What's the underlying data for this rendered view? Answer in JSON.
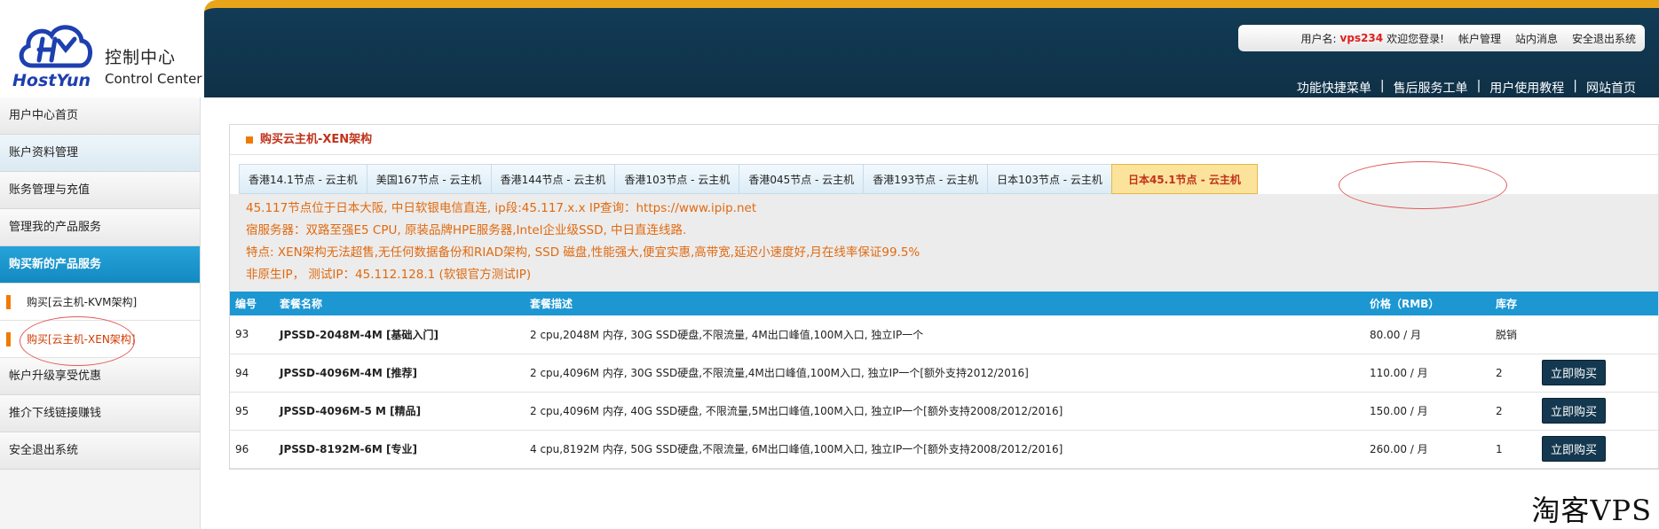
{
  "brand": {
    "logo_text": "HostYun",
    "title_cn": "控制中心",
    "title_en": "Control Center"
  },
  "user_bar": {
    "username_label": "用户名:",
    "username": "vps234",
    "welcome": "欢迎您登录!",
    "links": [
      "帐户管理",
      "站内消息",
      "安全退出系统"
    ]
  },
  "top_nav": [
    "功能快捷菜单",
    "售后服务工单",
    "用户使用教程",
    "网站首页"
  ],
  "sidebar": {
    "items": [
      {
        "label": "用户中心首页"
      },
      {
        "label": "账户资料管理"
      },
      {
        "label": "账务管理与充值"
      },
      {
        "label": "管理我的产品服务"
      },
      {
        "label": "购买新的产品服务"
      }
    ],
    "sub_items": [
      {
        "label": "购买[云主机-KVM架构]"
      },
      {
        "label": "购买[云主机-XEN架构]"
      }
    ],
    "bottom_items": [
      {
        "label": "帐户升级享受优惠"
      },
      {
        "label": "推介下线链接赚钱"
      },
      {
        "label": "安全退出系统"
      }
    ]
  },
  "panel": {
    "title": "购买云主机-XEN架构",
    "tabs": [
      "香港14.1节点 - 云主机",
      "美国167节点 - 云主机",
      "香港144节点 - 云主机",
      "香港103节点 - 云主机",
      "香港045节点 - 云主机",
      "香港193节点 - 云主机",
      "日本103节点 - 云主机",
      "日本45.1节点 - 云主机"
    ],
    "info_lines": [
      "45.117节点位于日本大阪, 中日软银电信直连, ip段:45.117.x.x IP查询：https://www.ipip.net",
      "宿服务器：双路至强E5 CPU, 原装品牌HPE服务器,Intel企业级SSD, 中日直连线路.",
      "特点: XEN架构无法超售,无任何数据备份和RIAD架构, SSD 磁盘,性能强大,便宜实惠,高带宽,延迟小速度好,月在线率保证99.5%",
      "非原生IP， 测试IP：45.112.128.1 (软银官方测试IP)"
    ],
    "table": {
      "headers": [
        "编号",
        "套餐名称",
        "套餐描述",
        "价格（RMB）",
        "库存",
        ""
      ],
      "rows": [
        {
          "id": "93",
          "name": "JPSSD-2048M-4M [基础入门]",
          "desc": "2 cpu,2048M 内存, 30G SSD硬盘,不限流量, 4M出口峰值,100M入口, 独立IP一个",
          "price": "80.00 / 月",
          "stock": "脱销",
          "action": ""
        },
        {
          "id": "94",
          "name": "JPSSD-4096M-4M [推荐]",
          "desc": "2 cpu,4096M 内存, 30G SSD硬盘,不限流量,4M出口峰值,100M入口, 独立IP一个[额外支持2012/2016]",
          "price": "110.00 / 月",
          "stock": "2",
          "action": "立即购买"
        },
        {
          "id": "95",
          "name": "JPSSD-4096M-5 M [精品]",
          "desc": "2 cpu,4096M 内存, 40G SSD硬盘, 不限流量,5M出口峰值,100M入口, 独立IP一个[额外支持2008/2012/2016]",
          "price": "150.00 / 月",
          "stock": "2",
          "action": "立即购买"
        },
        {
          "id": "96",
          "name": "JPSSD-8192M-6M [专业]",
          "desc": "4 cpu,8192M 内存, 50G SSD硬盘,不限流量, 6M出口峰值,100M入口, 独立IP一个[额外支持2008/2012/2016]",
          "price": "260.00 / 月",
          "stock": "1",
          "action": "立即购买"
        }
      ]
    }
  },
  "watermark": "淘客VPS",
  "colors": {
    "accent": "#1c97d2",
    "banner": "#123b55",
    "highlight": "#e06a10",
    "button": "#14384f"
  }
}
